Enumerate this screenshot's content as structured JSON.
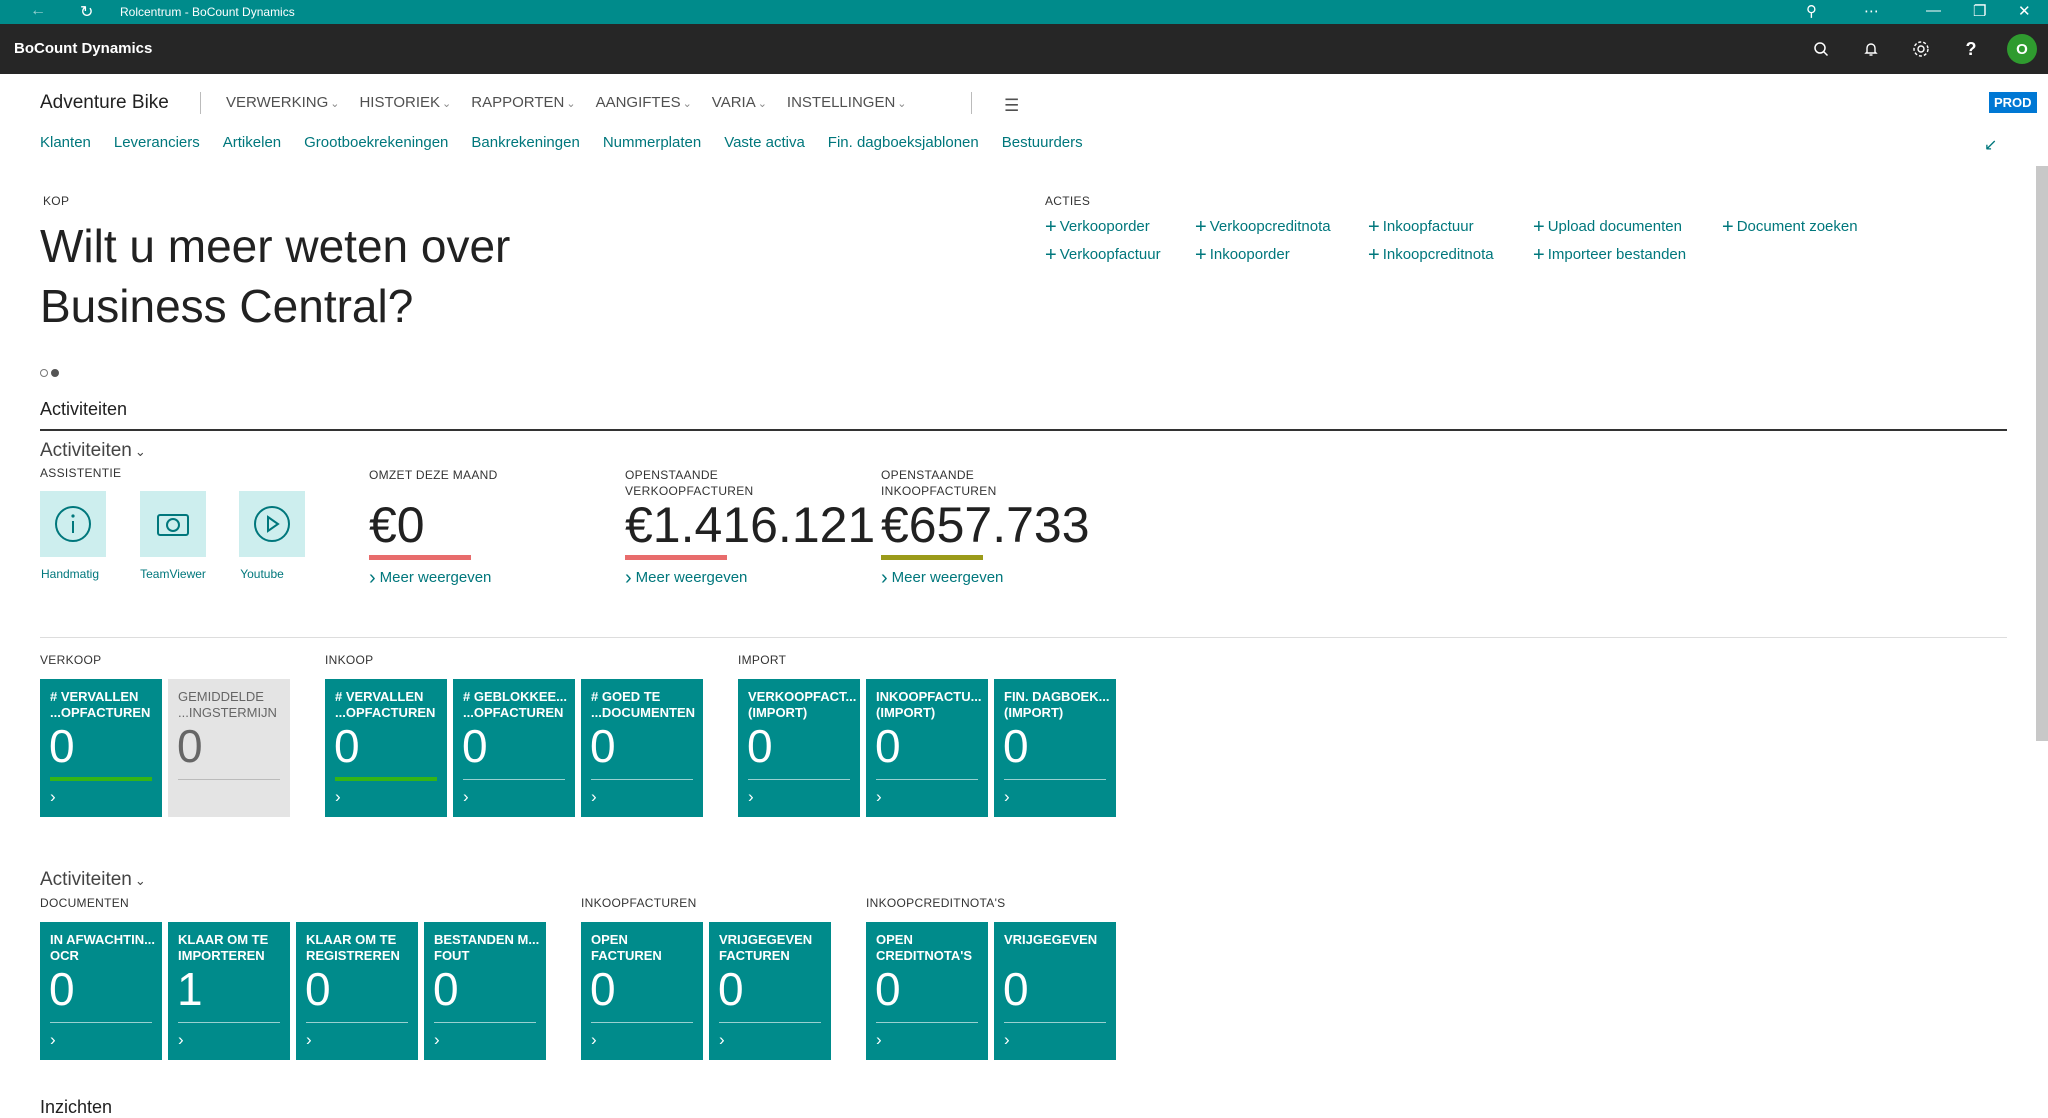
{
  "window": {
    "title": "Rolcentrum - BoCount Dynamics"
  },
  "app": {
    "name": "BoCount Dynamics",
    "avatar": "O"
  },
  "nav": {
    "company": "Adventure Bike",
    "menus": [
      "VERWERKING",
      "HISTORIEK",
      "RAPPORTEN",
      "AANGIFTES",
      "VARIA",
      "INSTELLINGEN"
    ],
    "env": "PROD",
    "links": [
      "Klanten",
      "Leveranciers",
      "Artikelen",
      "Grootboekrekeningen",
      "Bankrekeningen",
      "Nummerplaten",
      "Vaste activa",
      "Fin. dagboeksjablonen",
      "Bestuurders"
    ]
  },
  "headline": {
    "label": "KOP",
    "text": "Wilt u meer weten over Business Central?"
  },
  "actions": {
    "label": "ACTIES",
    "items": [
      "Verkooporder",
      "Verkoopcreditnota",
      "Inkoopfactuur",
      "Upload documenten",
      "Document zoeken",
      "Verkoopfactuur",
      "Inkooporder",
      "Inkoopcreditnota",
      "Importeer bestanden"
    ]
  },
  "activities": {
    "title": "Activiteiten",
    "sub1": "Activiteiten",
    "assist_label": "ASSISTENTIE",
    "assist": [
      {
        "label": "Handmatig",
        "icon": "info-icon"
      },
      {
        "label": "TeamViewer",
        "icon": "camera-icon"
      },
      {
        "label": "Youtube",
        "icon": "play-icon"
      }
    ],
    "kpis": [
      {
        "label": "OMZET DEZE MAAND",
        "value": "€0",
        "more": "Meer weergeven",
        "color": "#e86c6c"
      },
      {
        "label": "OPENSTAANDE VERKOOPFACTUREN",
        "value": "€1.416.121",
        "more": "Meer weergeven",
        "color": "#e86c6c"
      },
      {
        "label": "OPENSTAANDE INKOOPFACTUREN",
        "value": "€657.733",
        "more": "Meer weergeven",
        "color": "#9b9b1a"
      }
    ]
  },
  "groups": {
    "verkoop": "VERKOOP",
    "inkoop": "INKOOP",
    "import": "IMPORT",
    "documenten": "DOCUMENTEN",
    "inkoopfacturen": "INKOOPFACTUREN",
    "inkoopcreditnotas": "INKOOPCREDITNOTA'S",
    "sub2": "Activiteiten"
  },
  "tiles": [
    {
      "title": "# VERVALLEN ...OPFACTUREN",
      "value": "0"
    },
    {
      "title": "GEMIDDELDE ...INGSTERMIJN",
      "value": "0"
    },
    {
      "title": "# VERVALLEN ...OPFACTUREN",
      "value": "0"
    },
    {
      "title": "# GEBLOKKEE... ...OPFACTUREN",
      "value": "0"
    },
    {
      "title": "# GOED TE ...DOCUMENTEN",
      "value": "0"
    },
    {
      "title": "VERKOOPFACT... (IMPORT)",
      "value": "0"
    },
    {
      "title": "INKOOPFACTU... (IMPORT)",
      "value": "0"
    },
    {
      "title": "FIN. DAGBOEK... (IMPORT)",
      "value": "0"
    },
    {
      "title": "IN AFWACHTIN... OCR",
      "value": "0"
    },
    {
      "title": "KLAAR OM TE IMPORTEREN",
      "value": "1"
    },
    {
      "title": "KLAAR OM TE REGISTREREN",
      "value": "0"
    },
    {
      "title": "BESTANDEN M... FOUT",
      "value": "0"
    },
    {
      "title": "OPEN FACTUREN",
      "value": "0"
    },
    {
      "title": "VRIJGEGEVEN FACTUREN",
      "value": "0"
    },
    {
      "title": "OPEN CREDITNOTA'S",
      "value": "0"
    },
    {
      "title": "VRIJGEGEVEN",
      "value": "0"
    }
  ],
  "insights": {
    "title": "Inzichten"
  }
}
